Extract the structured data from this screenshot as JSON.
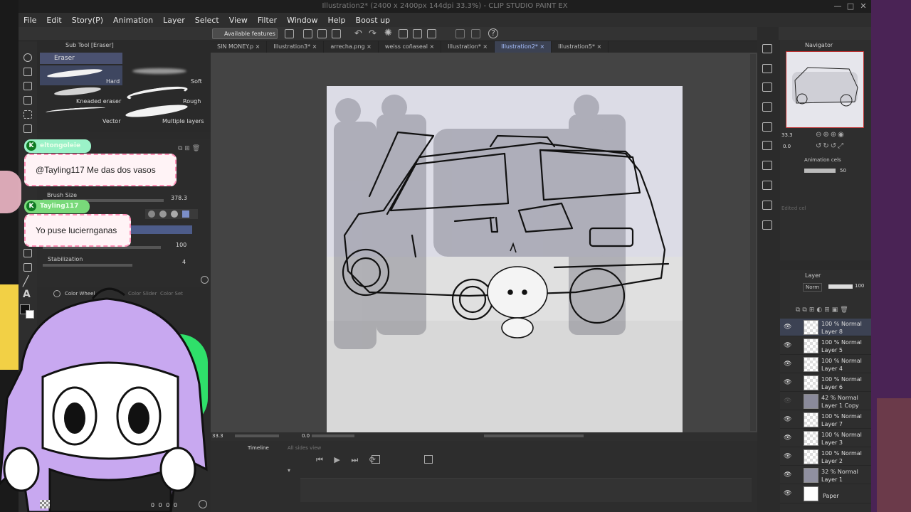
{
  "window": {
    "title": "Illustration2* (2400 x 2400px 144dpi 33.3%)  - CLIP STUDIO PAINT EX",
    "minimize_glyph": "—",
    "maximize_glyph": "□",
    "close_glyph": "✕"
  },
  "menu": [
    "File",
    "Edit",
    "Story(P)",
    "Animation",
    "Layer",
    "Select",
    "View",
    "Filter",
    "Window",
    "Help",
    "Boost up"
  ],
  "command_bar": {
    "available_features": "Available features"
  },
  "tabs": [
    {
      "label": "SIN MONEY.p"
    },
    {
      "label": "Illustration3*"
    },
    {
      "label": "arrecha.png"
    },
    {
      "label": "weiss coñaseal"
    },
    {
      "label": "Illustration*"
    },
    {
      "label": "Illustration2*",
      "active": true
    },
    {
      "label": "Illustration5*"
    }
  ],
  "sub_tool": {
    "panel_title": "Sub Tool [Eraser]",
    "group": "Eraser",
    "brushes": [
      "Hard",
      "Soft",
      "Kneaded eraser",
      "Rough",
      "Vector",
      "Multiple layers"
    ]
  },
  "tool_property": {
    "brush_size_label": "Brush Size",
    "brush_size_value": "378.3",
    "hardness_value": "100",
    "stabilization_label": "Stabilization",
    "stabilization_value": "4"
  },
  "color_panel": {
    "tabs": [
      "Color Wheel",
      "Color Slider",
      "Color Set"
    ]
  },
  "chat": [
    {
      "user": "eltongoleie",
      "message": "@Tayling117 Me das dos vasos"
    },
    {
      "user": "Tayling117",
      "message": "Yo puse luciernganas"
    }
  ],
  "status": {
    "zoom": "33.3",
    "rotation": "0.0"
  },
  "timeline": {
    "title": "Timeline",
    "sub": "All sides view"
  },
  "navigator": {
    "title": "Navigator",
    "zoom": "33.3",
    "rotation": "0.0",
    "animation_cels": "Animation cels",
    "opacity": "50",
    "edited_cel": "Edited cel"
  },
  "layers": {
    "title": "Layer",
    "blend_mode": "Norm",
    "opacity": "100",
    "items": [
      {
        "mode": "100 % Normal",
        "name": "Layer 8",
        "selected": true
      },
      {
        "mode": "100 % Normal",
        "name": "Layer 5"
      },
      {
        "mode": "100 % Normal",
        "name": "Layer 4"
      },
      {
        "mode": "100 % Normal",
        "name": "Layer 6"
      },
      {
        "mode": "42 % Normal",
        "name": "Layer 1 Copy"
      },
      {
        "mode": "100 % Normal",
        "name": "Layer 7"
      },
      {
        "mode": "100 % Normal",
        "name": "Layer 3"
      },
      {
        "mode": "100 % Normal",
        "name": "Layer 2"
      },
      {
        "mode": "32 % Normal",
        "name": "Layer 1"
      },
      {
        "mode": "",
        "name": "Paper"
      }
    ]
  },
  "bottom_left": {
    "values": "0 0 0 0"
  },
  "colors": {
    "accent": "#a8c0ff",
    "chat_border": "#ff8fb7",
    "purple": "#5a2d6b"
  }
}
